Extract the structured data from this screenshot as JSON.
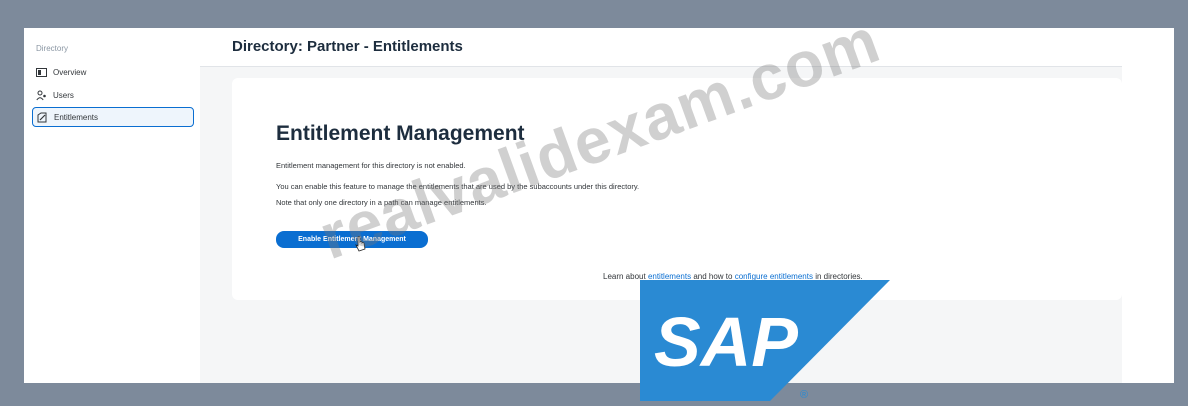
{
  "sidebar": {
    "heading": "Directory",
    "items": [
      {
        "label": "Overview",
        "icon": "overview-icon"
      },
      {
        "label": "Users",
        "icon": "users-icon"
      },
      {
        "label": "Entitlements",
        "icon": "entitlements-icon",
        "active": true
      }
    ]
  },
  "header": {
    "title": "Directory: Partner - Entitlements"
  },
  "card": {
    "title": "Entitlement Management",
    "lines": [
      "Entitlement management for this directory is not enabled.",
      "You can enable this feature to manage the entitlements that are used by the subaccounts under this directory.",
      "Note that only one directory in a path can manage entitlements."
    ],
    "button_label": "Enable Entitlement Management",
    "learn": {
      "prefix": "Learn about",
      "link1": "entitlements",
      "middle": "and how to",
      "link2": "configure entitlements",
      "suffix": "in directories."
    }
  },
  "overlay": {
    "watermark": "realvalidexam.com",
    "logo_text": "SAP",
    "logo_mark": "®"
  },
  "colors": {
    "accent": "#0a6ed1",
    "page_background": "#7d8a9b",
    "logo_blue": "#2a8ad3"
  }
}
